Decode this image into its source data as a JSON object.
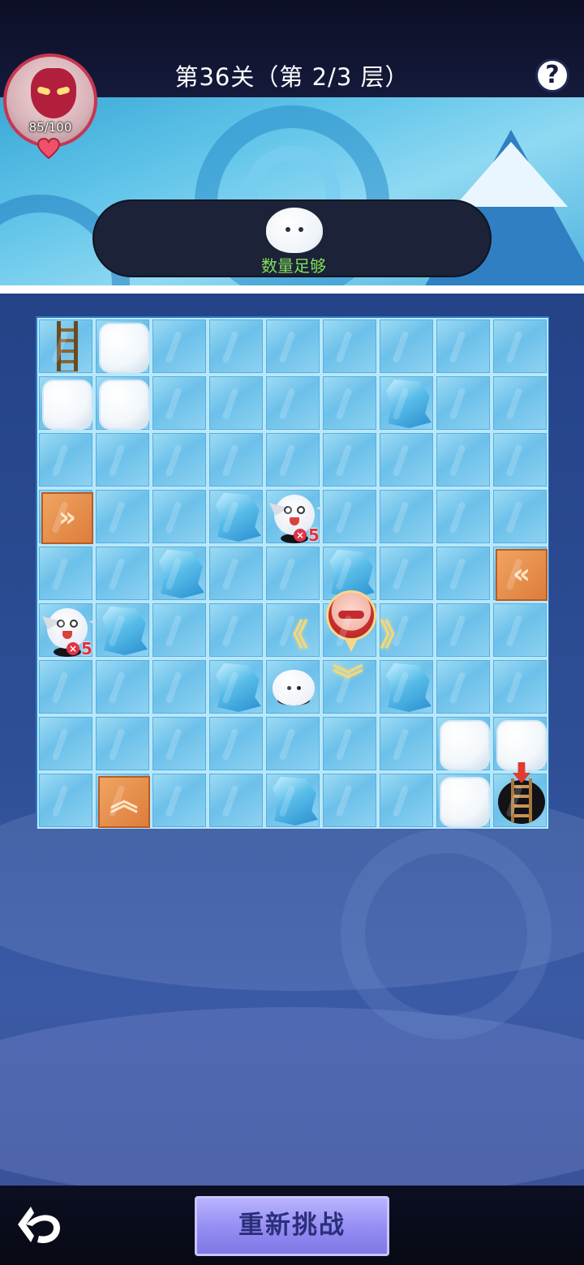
{
  "header": {
    "title": "第36关（第 2/3 层）",
    "help_label": "?"
  },
  "player": {
    "hp_text": "85/100"
  },
  "info_panel": {
    "status_text": "数量足够"
  },
  "board": {
    "rows": 9,
    "cols": 9,
    "tiles": [
      {
        "row": 0,
        "col": 0,
        "type": "ladder-up"
      },
      {
        "row": 0,
        "col": 1,
        "type": "snow-block"
      },
      {
        "row": 1,
        "col": 0,
        "type": "snow-block"
      },
      {
        "row": 1,
        "col": 1,
        "type": "snow-block"
      },
      {
        "row": 1,
        "col": 6,
        "type": "ice-rock"
      },
      {
        "row": 3,
        "col": 0,
        "type": "arrow-tile",
        "glyph": "»"
      },
      {
        "row": 3,
        "col": 3,
        "type": "ice-rock"
      },
      {
        "row": 3,
        "col": 4,
        "type": "ghost-enemy",
        "count": "5"
      },
      {
        "row": 4,
        "col": 2,
        "type": "ice-rock"
      },
      {
        "row": 4,
        "col": 5,
        "type": "ice-rock"
      },
      {
        "row": 4,
        "col": 8,
        "type": "arrow-tile",
        "glyph": "«"
      },
      {
        "row": 5,
        "col": 0,
        "type": "ghost-enemy",
        "count": "5"
      },
      {
        "row": 5,
        "col": 1,
        "type": "ice-rock"
      },
      {
        "row": 5,
        "col": 5,
        "type": "hero"
      },
      {
        "row": 6,
        "col": 3,
        "type": "ice-rock"
      },
      {
        "row": 6,
        "col": 4,
        "type": "seal"
      },
      {
        "row": 6,
        "col": 6,
        "type": "ice-rock"
      },
      {
        "row": 7,
        "col": 7,
        "type": "snow-block"
      },
      {
        "row": 7,
        "col": 8,
        "type": "snow-block"
      },
      {
        "row": 8,
        "col": 1,
        "type": "arrow-tile",
        "glyph": "︽"
      },
      {
        "row": 8,
        "col": 4,
        "type": "ice-rock"
      },
      {
        "row": 8,
        "col": 7,
        "type": "snow-block"
      },
      {
        "row": 8,
        "col": 8,
        "type": "exit-ladder"
      }
    ],
    "move_hints": {
      "left": "《",
      "right": "》",
      "down": "︾"
    }
  },
  "footer": {
    "retry_label": "重新挑战"
  },
  "icons": {
    "help": "question-mark-icon",
    "back": "back-arrow-icon",
    "heart": "heart-icon"
  },
  "colors": {
    "accent_button": "#938cf2",
    "status_green": "#7fe05a",
    "enemy_count_red": "#e3303f",
    "arrow_tile_orange": "#dd7d3b"
  }
}
